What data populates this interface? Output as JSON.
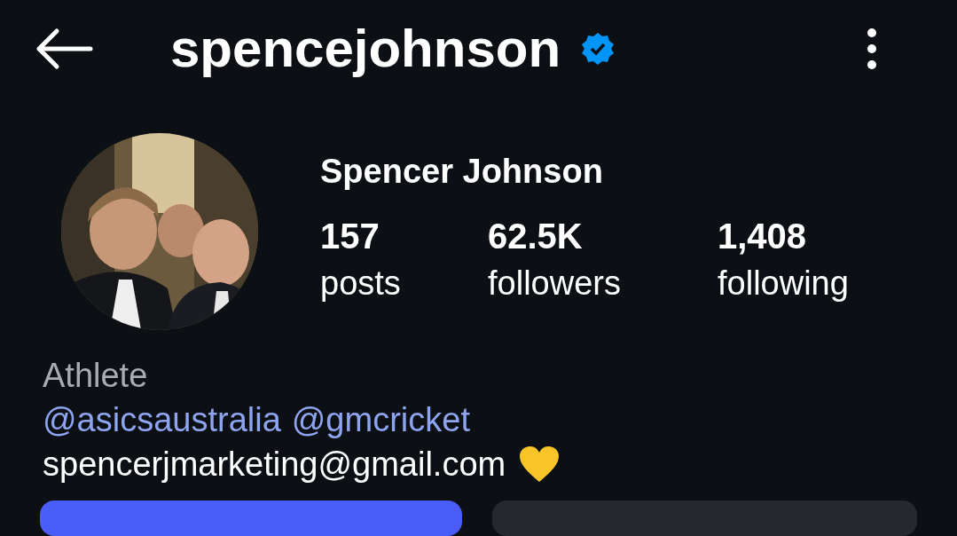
{
  "header": {
    "username": "spencejohnson",
    "verified": true
  },
  "profile": {
    "name": "Spencer Johnson",
    "stats": [
      {
        "value": "157",
        "label": "posts"
      },
      {
        "value": "62.5K",
        "label": "followers"
      },
      {
        "value": "1,408",
        "label": "following"
      }
    ]
  },
  "bio": {
    "category": "Athlete",
    "links": [
      "@asicsaustralia",
      "@gmcricket"
    ],
    "email": "spencerjmarketing@gmail.com"
  }
}
